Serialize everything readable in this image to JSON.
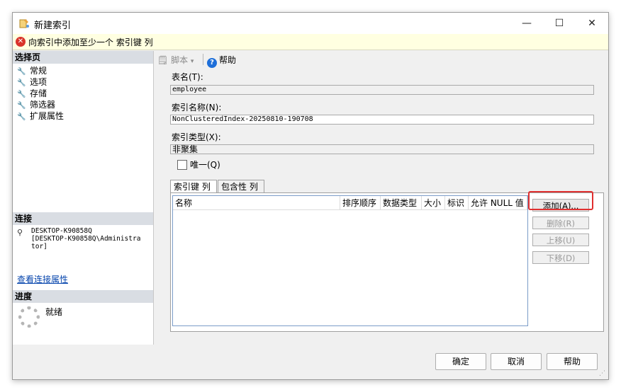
{
  "window": {
    "title": "新建索引",
    "minimize": "—",
    "maximize": "☐",
    "close": "✕"
  },
  "error": {
    "message": "向索引中添加至少一个 索引键 列"
  },
  "left_pane": {
    "select_page_header": "选择页",
    "pages": [
      "常规",
      "选项",
      "存储",
      "筛选器",
      "扩展属性"
    ],
    "connection_header": "连接",
    "connection_text": "DESKTOP-K90858Q\n[DESKTOP-K90858Q\\Administra\ntor]",
    "view_connection_link": "查看连接属性",
    "progress_header": "进度",
    "progress_status": "就绪"
  },
  "toolbar": {
    "script_label": "脚本",
    "help_label": "帮助"
  },
  "form": {
    "table_name_label": "表名(T):",
    "table_name_value": "employee",
    "index_name_label": "索引名称(N):",
    "index_name_value": "NonClusteredIndex-20250810-190708",
    "index_type_label": "索引类型(X):",
    "index_type_value": "非聚集",
    "unique_label": "唯一(Q)",
    "unique_checked": false
  },
  "tabs": [
    "索引键 列",
    "包含性 列"
  ],
  "grid_columns": [
    "名称",
    "排序顺序",
    "数据类型",
    "大小",
    "标识",
    "允许 NULL 值"
  ],
  "side_buttons": {
    "add": "添加(A)...",
    "remove": "删除(R)",
    "move_up": "上移(U)",
    "move_down": "下移(D)"
  },
  "bottom_buttons": {
    "ok": "确定",
    "cancel": "取消",
    "help": "帮助"
  },
  "colors": {
    "error_bg": "#ffffe1",
    "section_header": "#d9dde3",
    "highlight": "#e03030",
    "link": "#0645ad"
  }
}
